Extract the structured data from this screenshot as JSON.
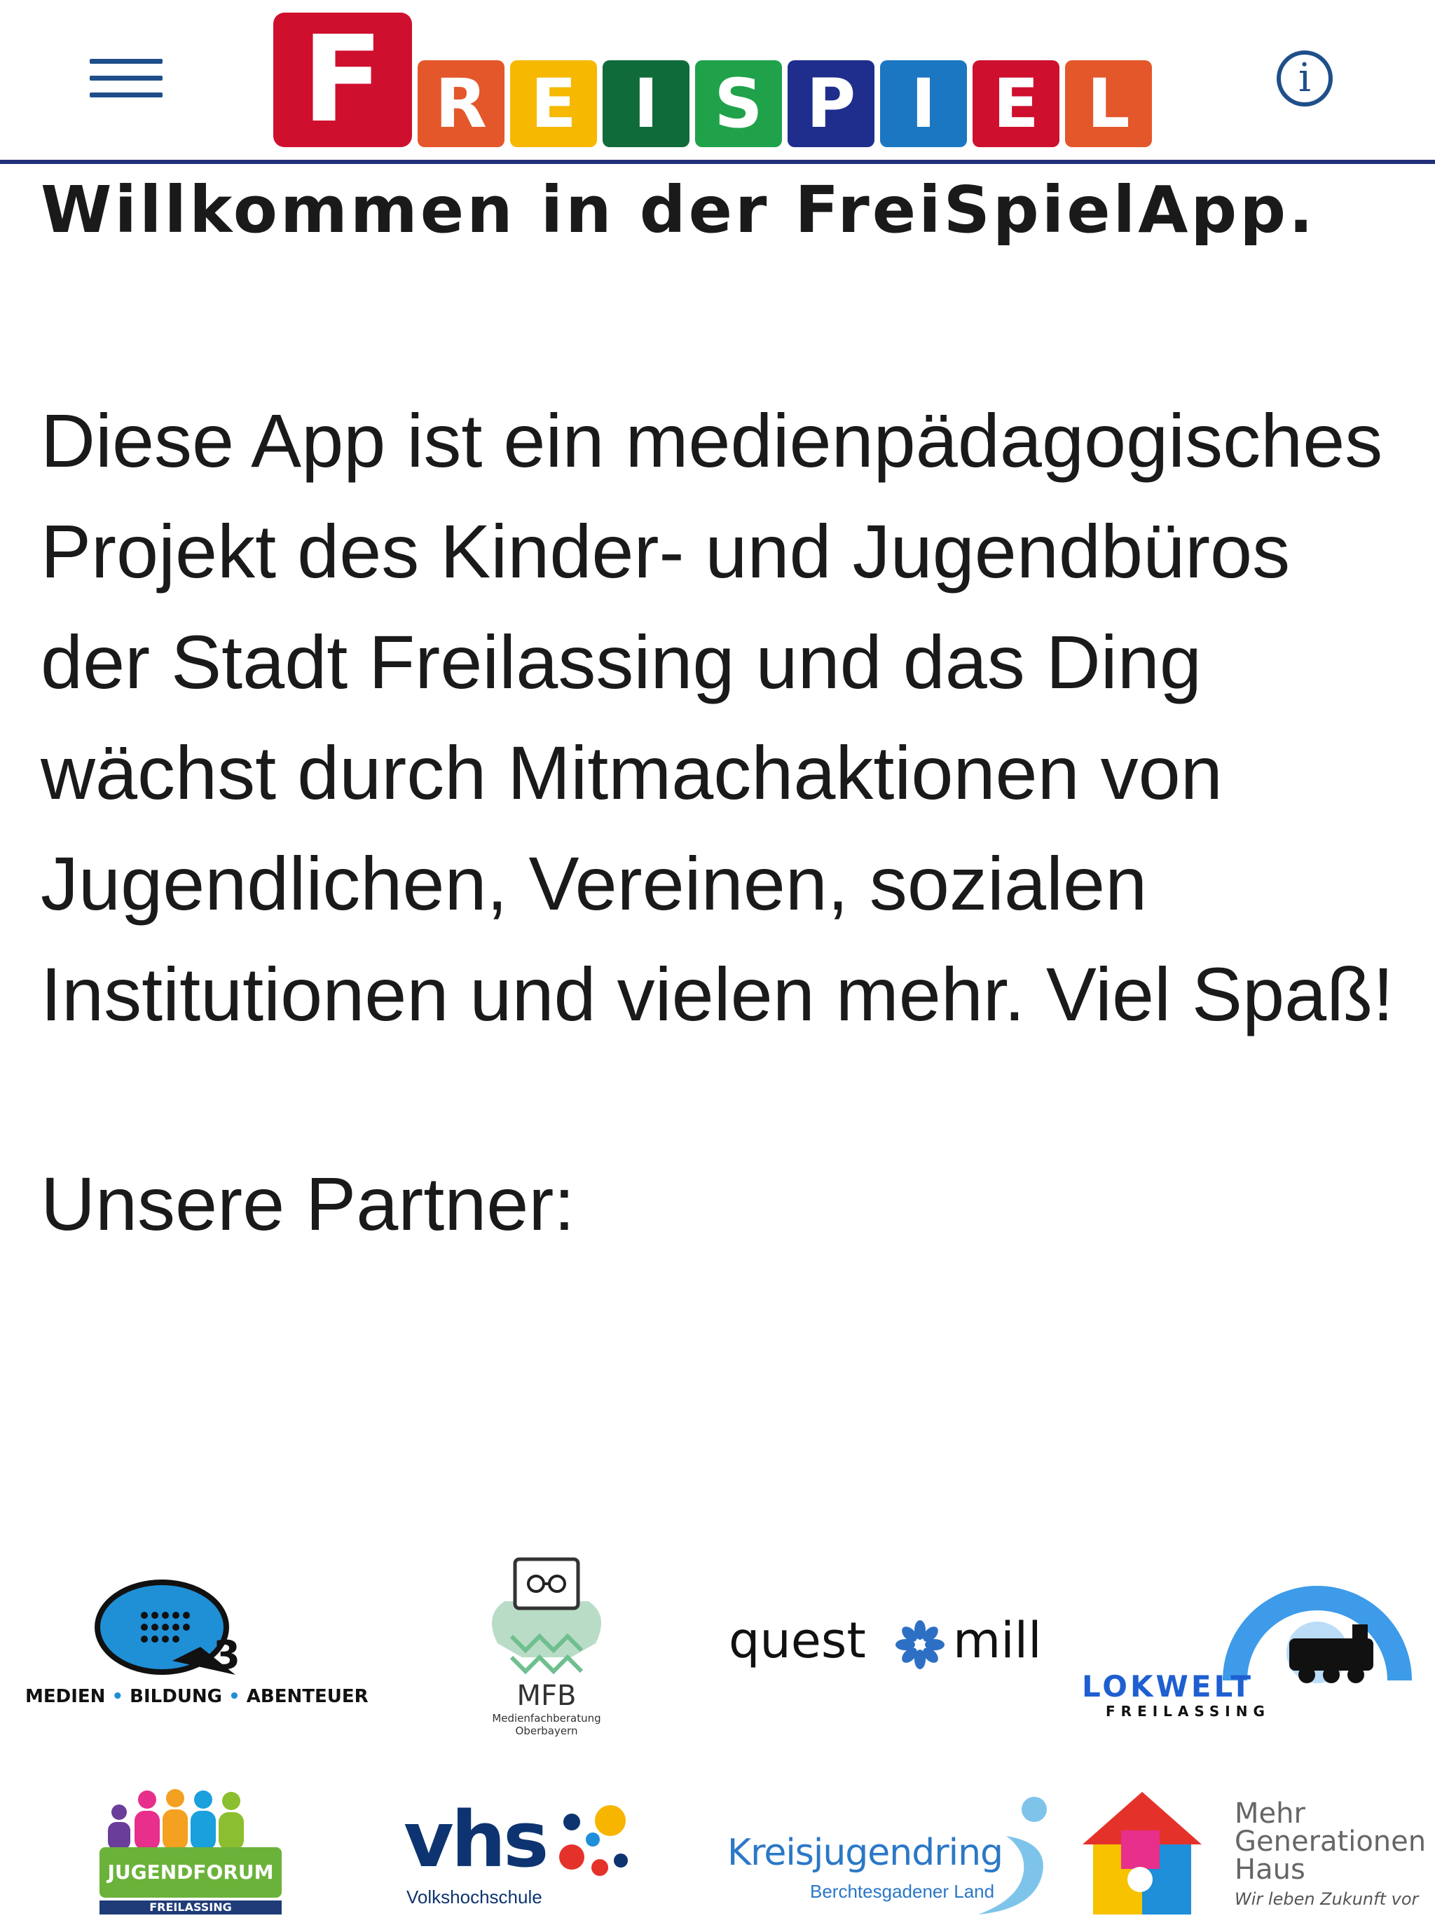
{
  "header": {
    "logo_letters": [
      "F",
      "R",
      "E",
      "I",
      "S",
      "P",
      "I",
      "E",
      "L"
    ],
    "logo_colors": [
      "#cf0f2e",
      "#e4572a",
      "#f6b800",
      "#0f6b3a",
      "#20a24a",
      "#1f2e8c",
      "#1c77c3",
      "#cf0f2e",
      "#e4572a"
    ],
    "menu_icon": "hamburger-icon",
    "info_icon": "info-circle-icon",
    "info_glyph": "i"
  },
  "content": {
    "headline": "Willkommen in der FreiSpielApp.",
    "intro": "Diese App ist ein medienpädagogisches Projekt des Kinder- und Jugendbüros der Stadt Freilassing und das Ding wächst durch Mitmachaktionen von Jugendlichen, Vereinen, sozialen Institutionen und vielen mehr. Viel Spaß!",
    "partners_title": "Unsere Partner:"
  },
  "partners": {
    "q3": {
      "badge": "3",
      "tagline_1": "MEDIEN",
      "tagline_2": "BILDUNG",
      "tagline_3": "ABENTEUER"
    },
    "mfb": {
      "name": "MFB",
      "sub_1": "Medienfachberatung",
      "sub_2": "Oberbayern"
    },
    "questmill": {
      "left": "quest",
      "right": "mill"
    },
    "lokwelt": {
      "name": "LOKWELT",
      "sub": "FREILASSING"
    },
    "jugendforum": {
      "name": "JUGENDFORUM",
      "sub": "FREILASSING"
    },
    "vhs": {
      "name": "vhs",
      "sub": "Volkshochschule"
    },
    "kreisjugendring": {
      "name": "Kreisjugendring",
      "sub": "Berchtesgadener Land"
    },
    "mgh": {
      "line_1": "Mehr",
      "line_2": "Generationen",
      "line_3": "Haus",
      "tagline": "Wir leben Zukunft vor"
    }
  }
}
